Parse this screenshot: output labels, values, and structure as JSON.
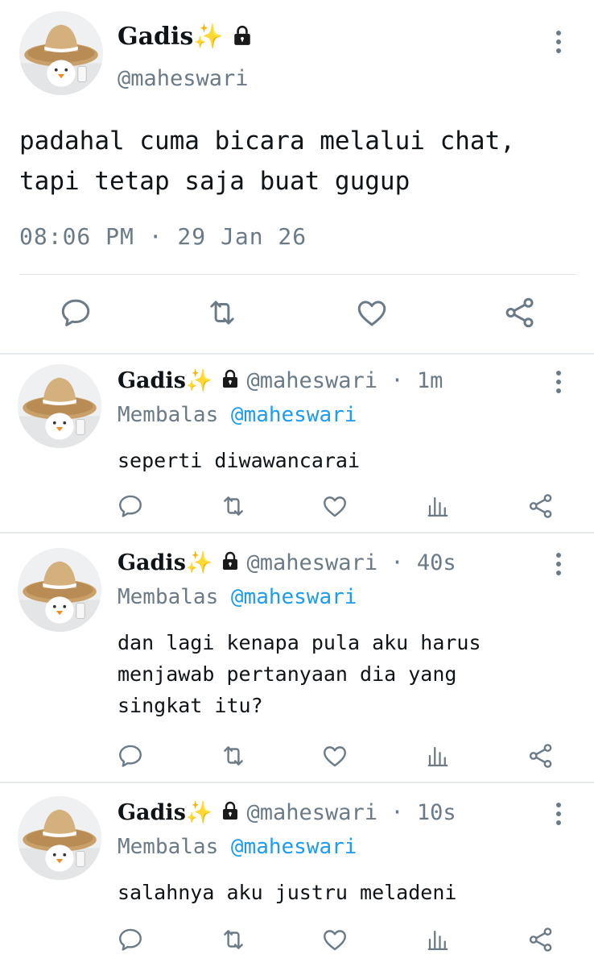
{
  "main_tweet": {
    "display_name": "Gadis",
    "sparkle": "✨",
    "handle": "@maheswari",
    "text_line1": "padahal cuma bicara melalui chat,",
    "text_line2": "tapi tetap saja buat gugup",
    "timestamp": "08:06 PM · 29 Jan 26",
    "actions": [
      "reply-icon",
      "retweet-icon",
      "like-icon",
      "share-icon"
    ]
  },
  "replies": [
    {
      "display_name": "Gadis",
      "sparkle": "✨",
      "handle_time": "@maheswari · 1m",
      "replying_prefix": "Membalas",
      "replying_to": "@maheswari",
      "text_lines": [
        "seperti diwawancarai"
      ]
    },
    {
      "display_name": "Gadis",
      "sparkle": "✨",
      "handle_time": "@maheswari · 40s",
      "replying_prefix": "Membalas",
      "replying_to": "@maheswari",
      "text_lines": [
        "dan lagi kenapa pula aku harus",
        "menjawab pertanyaan dia yang",
        "singkat itu?"
      ]
    },
    {
      "display_name": "Gadis",
      "sparkle": "✨",
      "handle_time": "@maheswari · 10s",
      "replying_prefix": "Membalas",
      "replying_to": "@maheswari",
      "text_lines": [
        "salahnya aku justru meladeni"
      ]
    }
  ],
  "colors": {
    "icon": "#6b7a87",
    "mention": "#1d9bf0",
    "text": "#0f1419",
    "divider": "#e1e6ea"
  }
}
